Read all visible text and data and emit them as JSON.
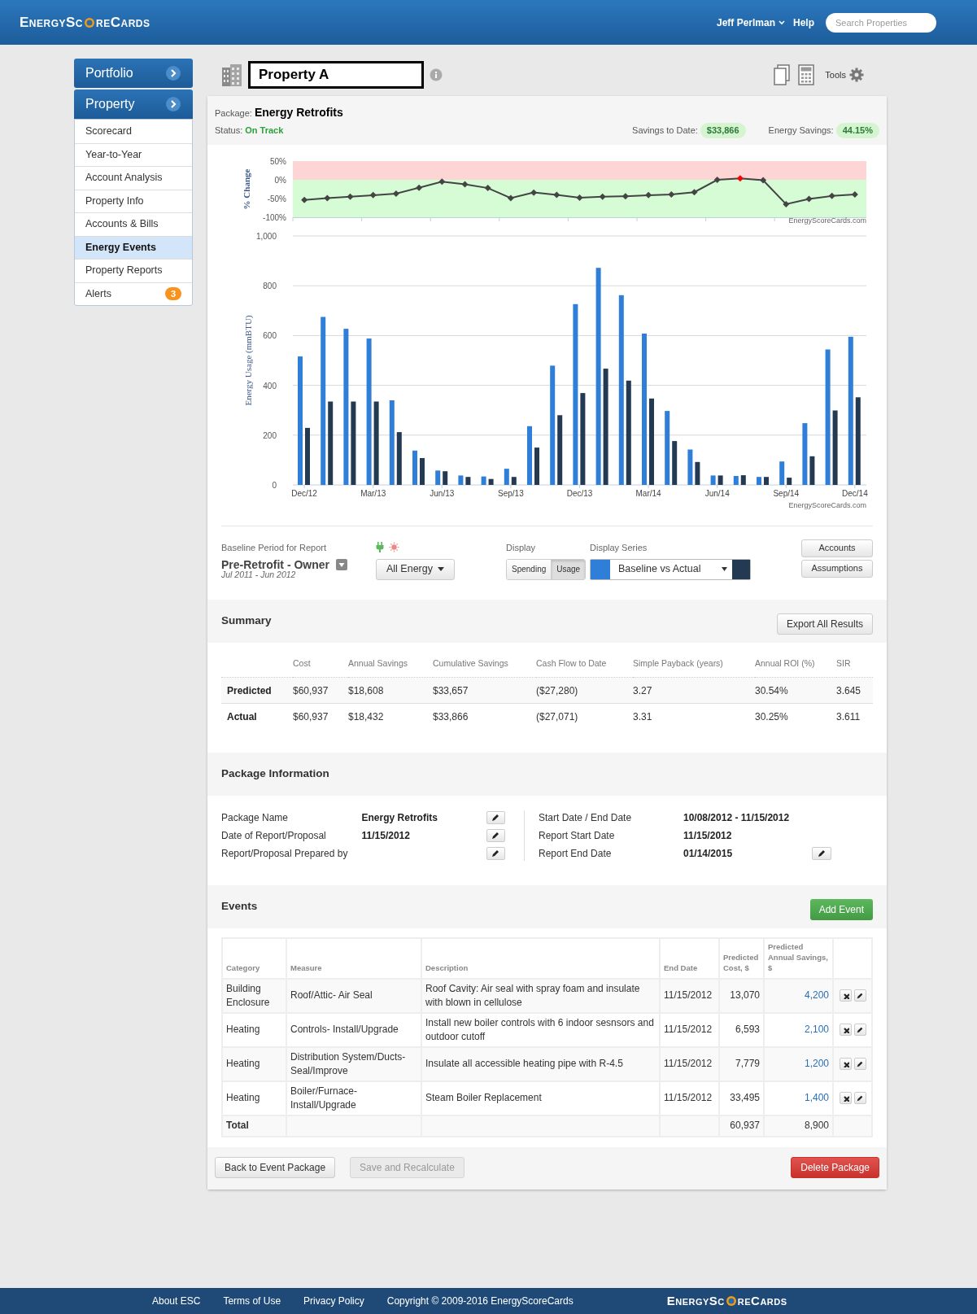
{
  "header": {
    "logo_before": "EnergySc",
    "logo_after": "reCards",
    "user": "Jeff Perlman",
    "help": "Help",
    "search_placeholder": "Search Properties"
  },
  "sidebar": {
    "sections": [
      {
        "label": "Portfolio"
      },
      {
        "label": "Property"
      }
    ],
    "items": [
      {
        "label": "Scorecard",
        "selected": false
      },
      {
        "label": "Year-to-Year",
        "selected": false
      },
      {
        "label": "Account Analysis",
        "selected": false
      },
      {
        "label": "Property Info",
        "selected": false
      },
      {
        "label": "Accounts & Bills",
        "selected": false
      },
      {
        "label": "Energy Events",
        "selected": true
      },
      {
        "label": "Property Reports",
        "selected": false
      },
      {
        "label": "Alerts",
        "selected": false,
        "badge": "3"
      }
    ]
  },
  "property": {
    "name": "Property A",
    "tools": "Tools"
  },
  "package": {
    "label": "Package:",
    "name": "Energy Retrofits",
    "status_label": "Status:",
    "status": "On Track",
    "savings_label": "Savings to Date:",
    "savings": "$33,866",
    "energy_label": "Energy Savings:",
    "energy": "44.15%"
  },
  "change_chart": {
    "credit": "EnergyScoreCards.com",
    "chart_data": {
      "type": "line",
      "ylabel": "% Change",
      "ylim": [
        -100,
        50
      ],
      "yticks": [
        {
          "value": 50,
          "label": "50%"
        },
        {
          "value": 0,
          "label": "0%"
        },
        {
          "value": -50,
          "label": "-50%"
        },
        {
          "value": -100,
          "label": "-100%"
        }
      ],
      "series": [
        {
          "color": "#444444",
          "marker": "diamond",
          "values": [
            -54,
            -49,
            -45,
            -41,
            -37,
            -21,
            -5,
            -12,
            -22,
            -49,
            -34,
            -40,
            -48,
            -45,
            -44,
            -41,
            -39,
            -33,
            0,
            null,
            -1,
            -65,
            -51,
            -43,
            -39
          ]
        },
        {
          "color": "#ff0000",
          "marker": "diamond",
          "values": [
            null,
            null,
            null,
            null,
            null,
            null,
            null,
            null,
            null,
            null,
            null,
            null,
            null,
            null,
            null,
            null,
            null,
            null,
            null,
            4,
            null,
            null,
            null,
            null,
            null
          ]
        }
      ]
    }
  },
  "usage_chart": {
    "credit": "EnergyScoreCards.com",
    "chart_data": {
      "type": "bar",
      "ylabel": "Energy Usage (mmBTU)",
      "grid": true,
      "categories": [
        "Dec/12",
        null,
        null,
        "Mar/13",
        null,
        null,
        "Jun/13",
        null,
        null,
        "Sep/13",
        null,
        null,
        "Dec/13",
        null,
        null,
        "Mar/14",
        null,
        null,
        "Jun/14",
        null,
        null,
        "Sep/14",
        null,
        null,
        "Dec/14"
      ],
      "ylim": [
        0,
        1000
      ],
      "yticks": [
        0,
        200,
        400,
        600,
        800,
        {
          "value": 1000,
          "label": "1,000"
        }
      ],
      "series": [
        {
          "color": "#2f7ed8",
          "values": [
            516,
            675,
            627,
            588,
            340,
            138,
            58,
            38,
            34,
            65,
            236,
            479,
            726,
            872,
            762,
            608,
            297,
            142,
            38,
            36,
            32,
            94,
            248,
            544,
            595
          ]
        },
        {
          "color": "#233a52",
          "values": [
            229,
            335,
            335,
            335,
            212,
            108,
            55,
            32,
            24,
            32,
            150,
            280,
            369,
            467,
            419,
            347,
            176,
            92,
            38,
            39,
            32,
            29,
            115,
            299,
            352
          ]
        }
      ]
    }
  },
  "controls": {
    "baseline_label": "Baseline Period for Report",
    "baseline": "Pre-Retrofit - Owner",
    "baseline_period": "Jul 2011 - Jun 2012",
    "energy": "All Energy",
    "display_label": "Display",
    "display_options": [
      {
        "label": "Spending",
        "selected": false
      },
      {
        "label": "Usage",
        "selected": true
      }
    ],
    "series_label": "Display Series",
    "series": "Baseline vs Actual",
    "buttons": [
      "Accounts",
      "Assumptions"
    ]
  },
  "summary": {
    "title": "Summary",
    "export": "Export All Results",
    "columns": [
      "Cost",
      "Annual Savings",
      "Cumulative Savings",
      "Cash Flow to Date",
      "Simple Payback (years)",
      "Annual ROI (%)",
      "SIR"
    ],
    "rows": [
      {
        "label": "Predicted",
        "cells": [
          "$60,937",
          "$18,608",
          "$33,657",
          "($27,280)",
          "3.27",
          "30.54%",
          "3.645"
        ]
      },
      {
        "label": "Actual",
        "cells": [
          "$60,937",
          "$18,432",
          "$33,866",
          "($27,071)",
          "3.31",
          "30.25%",
          "3.611"
        ]
      }
    ]
  },
  "package_info": {
    "title": "Package Information",
    "left": [
      {
        "label": "Package Name",
        "value": "Energy Retrofits",
        "editable": true
      },
      {
        "label": "Date of Report/Proposal",
        "value": "11/15/2012",
        "editable": true
      },
      {
        "label": "Report/Proposal Prepared by",
        "editable": true
      }
    ],
    "right": [
      {
        "label": "Start Date / End Date",
        "value": "10/08/2012 - 11/15/2012",
        "editable": false
      },
      {
        "label": "Report Start Date",
        "value": "11/15/2012",
        "editable": false
      },
      {
        "label": "Report End Date",
        "value": "01/14/2015",
        "editable": true
      }
    ]
  },
  "events": {
    "title": "Events",
    "add": "Add Event",
    "columns": [
      "Category",
      "Measure",
      "Description",
      "End Date",
      "Predicted Cost, $",
      "Predicted Annual Savings, $"
    ],
    "rows": [
      {
        "category": "Building Enclosure",
        "measure": "Roof/Attic- Air Seal",
        "description": "Roof Cavity: Air seal with spray foam and insulate with blown in cellulose",
        "end_date": "11/15/2012",
        "cost": "13,070",
        "savings": "4,200"
      },
      {
        "category": "Heating",
        "measure": "Controls- Install/Upgrade",
        "description": "Install new boiler controls with 6 indoor sesnsors and outdoor cutoff",
        "end_date": "11/15/2012",
        "cost": "6,593",
        "savings": "2,100"
      },
      {
        "category": "Heating",
        "measure": "Distribution System/Ducts-Seal/Improve",
        "description": "Insulate all accessible heating pipe with R-4.5",
        "end_date": "11/15/2012",
        "cost": "7,779",
        "savings": "1,200"
      },
      {
        "category": "Heating",
        "measure": "Boiler/Furnace-Install/Upgrade",
        "description": "Steam Boiler Replacement",
        "end_date": "11/15/2012",
        "cost": "33,495",
        "savings": "1,400"
      }
    ],
    "total": {
      "label": "Total",
      "cost": "60,937",
      "savings": "8,900"
    }
  },
  "actions": [
    {
      "label": "Back to Event Package",
      "kind": "default",
      "disabled": false
    },
    {
      "label": "Save and Recalculate",
      "kind": "default",
      "disabled": true
    },
    {
      "label": "Delete Package",
      "kind": "danger",
      "disabled": false
    }
  ],
  "footer": {
    "links": [
      "About ESC",
      "Terms of Use",
      "Privacy Policy"
    ],
    "copyright": "Copyright © 2009-2016 EnergyScoreCards",
    "logo_before": "EnergySc",
    "logo_after": "reCards"
  }
}
